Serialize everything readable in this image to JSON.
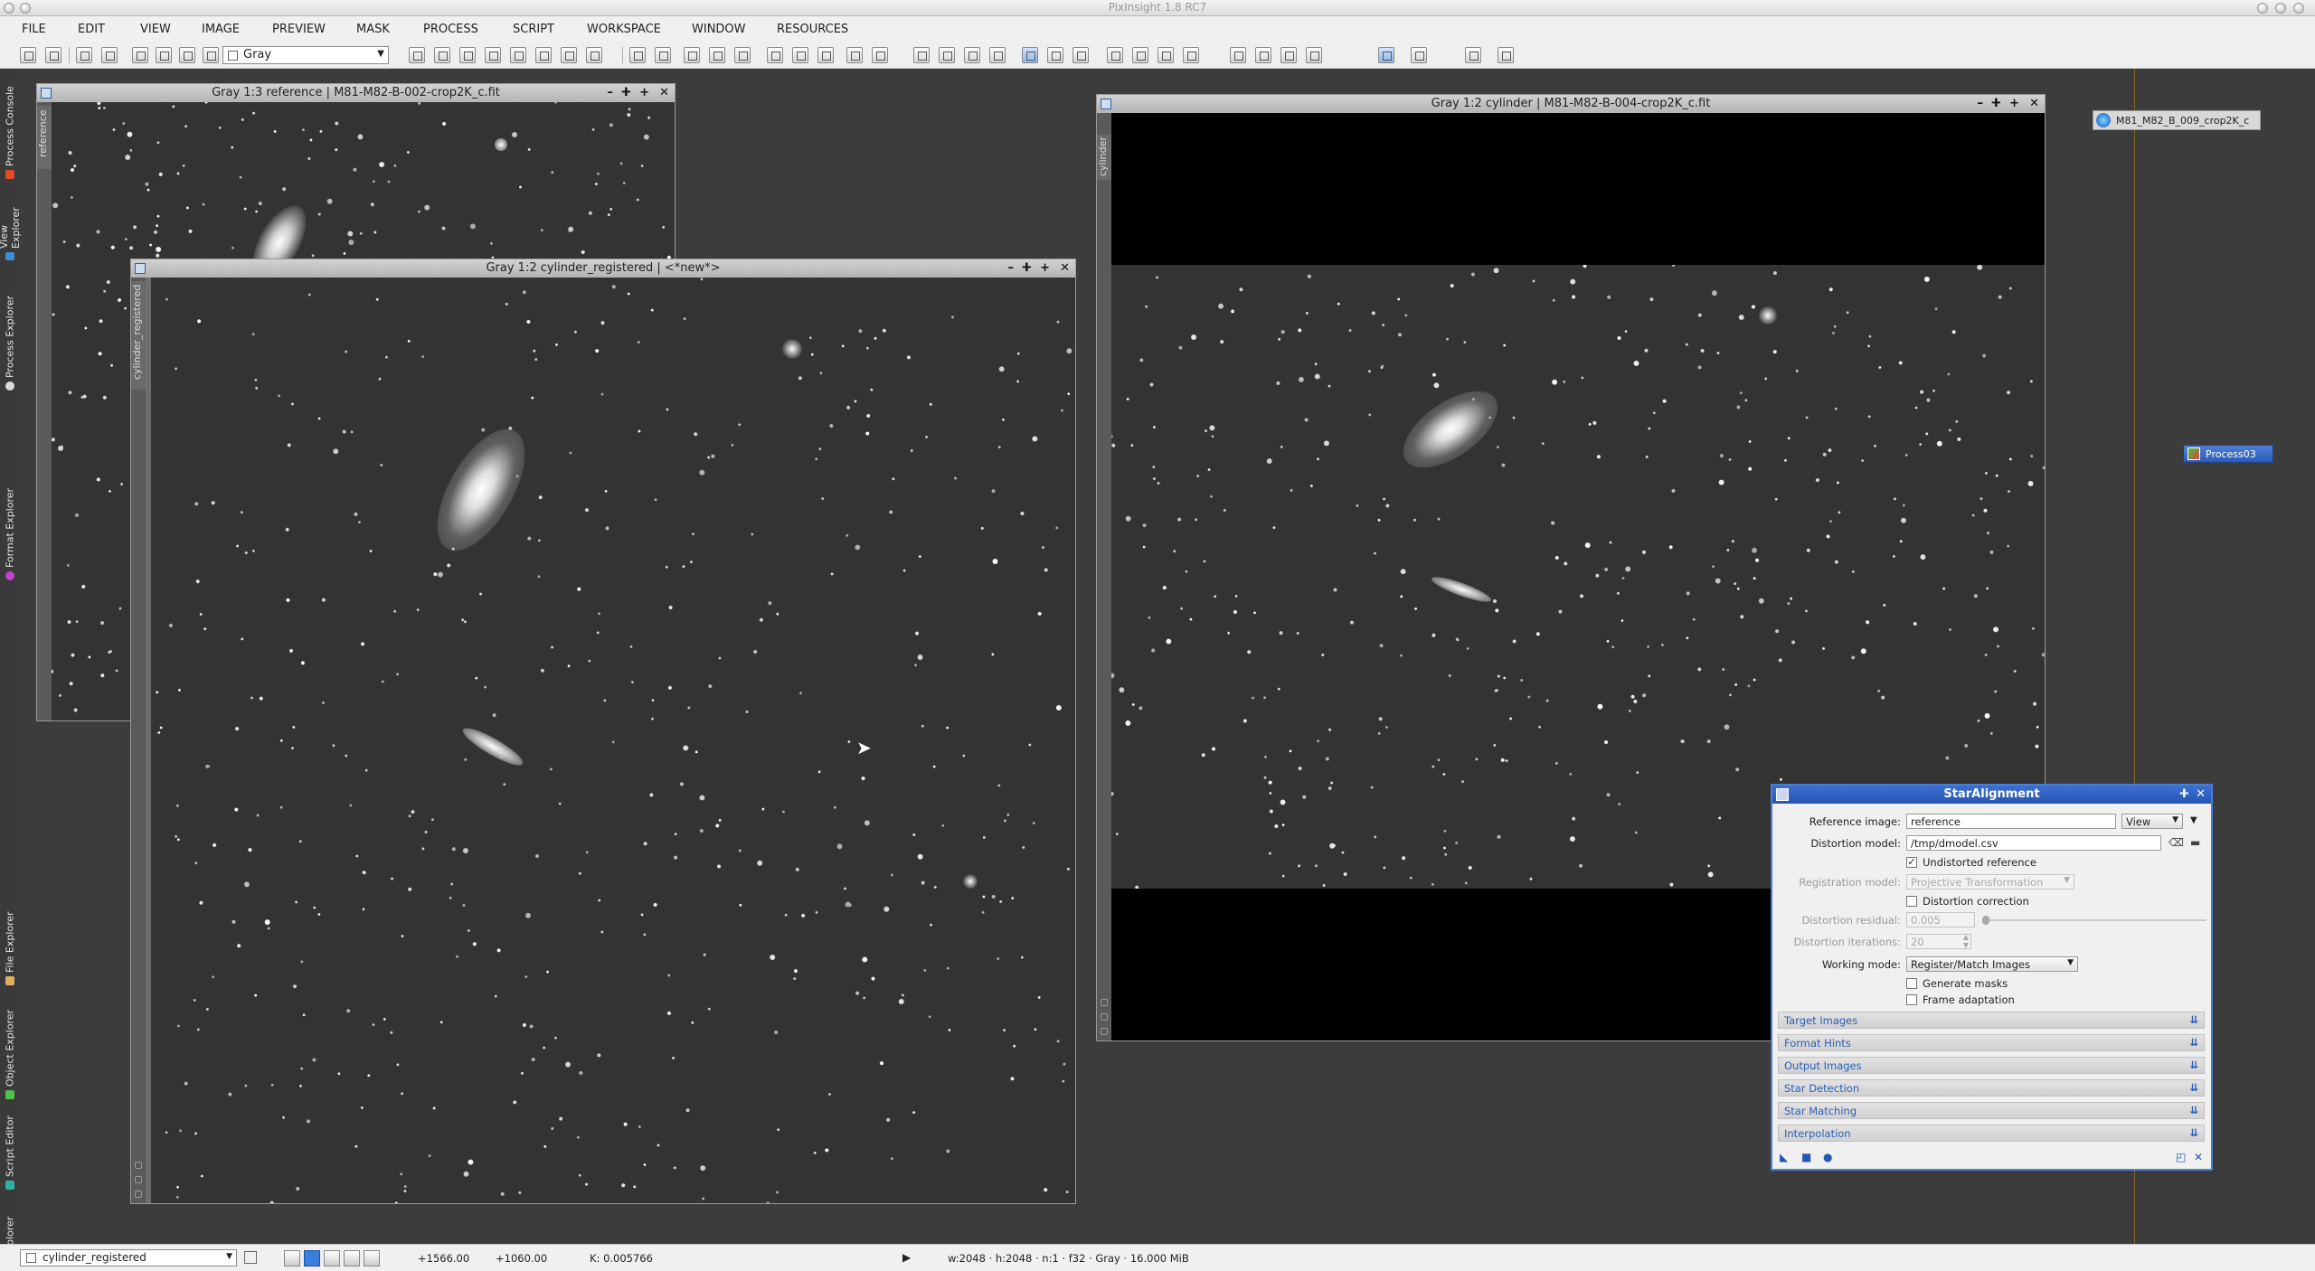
{
  "app": {
    "title": "PixInsight 1.8 RC7"
  },
  "menu": [
    "FILE",
    "EDIT",
    "VIEW",
    "IMAGE",
    "PREVIEW",
    "MASK",
    "PROCESS",
    "SCRIPT",
    "WORKSPACE",
    "WINDOW",
    "RESOURCES"
  ],
  "toolbar": {
    "color_space": "Gray"
  },
  "left_dock": [
    "Process Console",
    "View Explorer",
    "Process Explorer",
    "Format Explorer",
    "File Explorer",
    "Object Explorer",
    "Script Editor",
    "History Explorer"
  ],
  "windows": {
    "reference": {
      "title": "Gray 1:3 reference | M81-M82-B-002-crop2K_c.fit",
      "id": "reference"
    },
    "registered": {
      "title": "Gray 1:2 cylinder_registered | <*new*>",
      "id": "cylinder_registered"
    },
    "cylinder": {
      "title": "Gray 1:2 cylinder | M81-M82-B-004-crop2K_c.fit",
      "id": "cylinder"
    }
  },
  "desktop_icons": {
    "file_icon_label": "M81_M82_B_009_crop2K_c",
    "process_icon_label": "Process03"
  },
  "dialog": {
    "title": "StarAlignment",
    "reference_image_label": "Reference image:",
    "reference_image_value": "reference",
    "view_button": "View",
    "distortion_model_label": "Distortion model:",
    "distortion_model_value": "/tmp/dmodel.csv",
    "undistorted_reference_label": "Undistorted reference",
    "undistorted_reference_checked": true,
    "registration_model_label": "Registration model:",
    "registration_model_value": "Projective Transformation",
    "distortion_correction_label": "Distortion correction",
    "distortion_correction_checked": false,
    "distortion_residual_label": "Distortion residual:",
    "distortion_residual_value": "0.005",
    "distortion_iterations_label": "Distortion iterations:",
    "distortion_iterations_value": "20",
    "working_mode_label": "Working mode:",
    "working_mode_value": "Register/Match Images",
    "generate_masks_label": "Generate masks",
    "generate_masks_checked": false,
    "frame_adaptation_label": "Frame adaptation",
    "frame_adaptation_checked": false,
    "sections": [
      "Target Images",
      "Format Hints",
      "Output Images",
      "Star Detection",
      "Star Matching",
      "Interpolation"
    ]
  },
  "status": {
    "view": "cylinder_registered",
    "x": "+1566.00",
    "y": "+1060.00",
    "k": "K: 0.005766",
    "info": "w:2048 · h:2048 · n:1 · f32 · Gray · 16.000 MiB"
  },
  "colors": {
    "accent": "#2656b4",
    "dialog_border": "#4a7fd0",
    "desktop": "#3c3c3c",
    "section_text": "#2a5fb8"
  }
}
